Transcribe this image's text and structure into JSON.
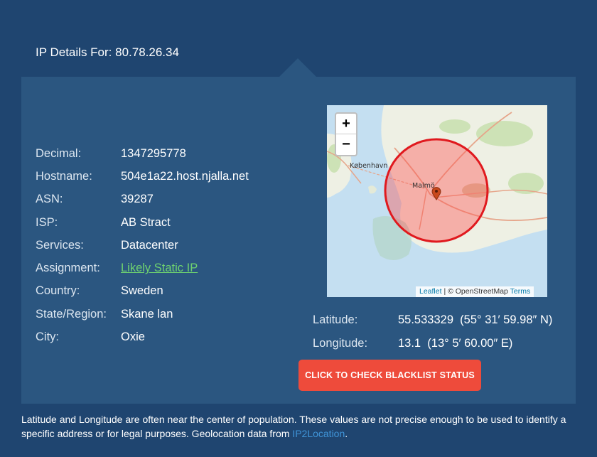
{
  "header": {
    "title": "IP Details For: 80.78.26.34"
  },
  "details": [
    {
      "label": "Decimal:",
      "value": "1347295778"
    },
    {
      "label": "Hostname:",
      "value": "504e1a22.host.njalla.net"
    },
    {
      "label": "ASN:",
      "value": "39287"
    },
    {
      "label": "ISP:",
      "value": "AB Stract"
    },
    {
      "label": "Services:",
      "value": "Datacenter"
    },
    {
      "label": "Assignment:",
      "value": "Likely Static IP"
    },
    {
      "label": "Country:",
      "value": "Sweden"
    },
    {
      "label": "State/Region:",
      "value": "Skane lan"
    },
    {
      "label": "City:",
      "value": "Oxie"
    }
  ],
  "map": {
    "zoom_in": "+",
    "zoom_out": "−",
    "city_labels": [
      "København",
      "Malmö"
    ],
    "attribution": {
      "leaflet": "Leaflet",
      "separator": " | © OpenStreetMap ",
      "terms": "Terms"
    },
    "circle_color": "#e0191e",
    "marker_color": "#c9491c"
  },
  "coords": [
    {
      "label": "Latitude:",
      "value": "55.533329  (55° 31′ 59.98″ N)"
    },
    {
      "label": "Longitude:",
      "value": "13.1  (13° 5′ 60.00″ E)"
    }
  ],
  "blacklist_button": "CLICK TO CHECK BLACKLIST STATUS",
  "footnote": {
    "text": "Latitude and Longitude are often near the center of population. These values are not precise enough to be used to identify a specific address or for legal purposes. Geolocation data from ",
    "source": "IP2Location",
    "end": "."
  },
  "colors": {
    "background": "#1f4570",
    "panel": "#2b5680",
    "button": "#ee4b3b",
    "link_green": "#6fd36f",
    "link_blue": "#3f94d8"
  }
}
